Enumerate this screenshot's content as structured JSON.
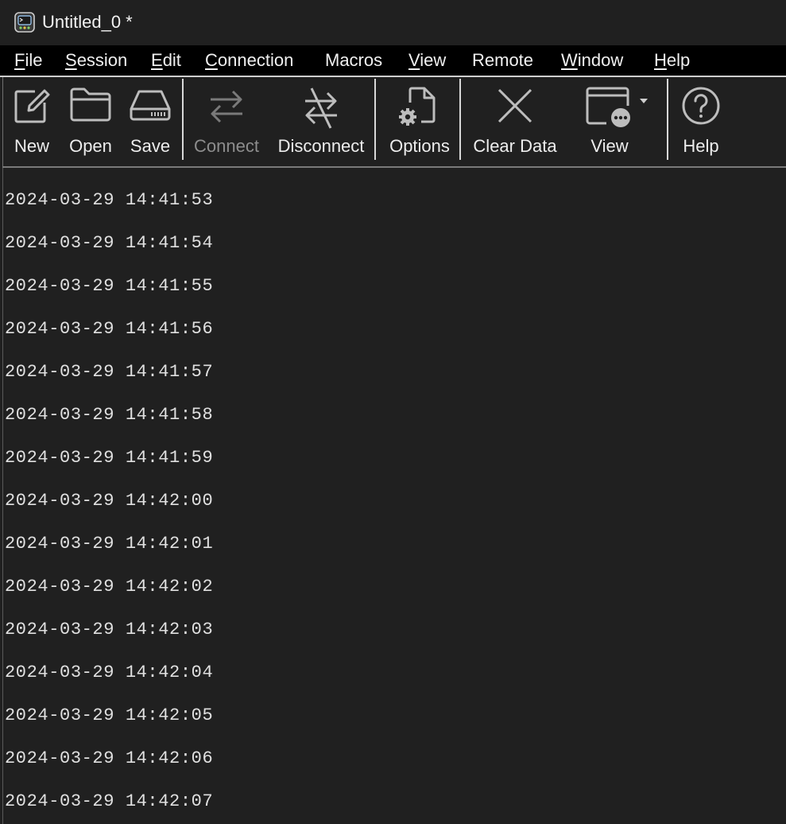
{
  "window": {
    "title": "Untitled_0 *",
    "app_icon": "serial-terminal-icon"
  },
  "menu": {
    "items": [
      {
        "underline": "F",
        "rest": "ile"
      },
      {
        "underline": "S",
        "rest": "ession"
      },
      {
        "underline": "E",
        "rest": "dit"
      },
      {
        "underline": "C",
        "rest": "onnection"
      },
      {
        "underline": "",
        "rest": "Macros"
      },
      {
        "underline": "V",
        "rest": "iew"
      },
      {
        "underline": "",
        "rest": "Remote"
      },
      {
        "underline": "W",
        "rest": "indow"
      },
      {
        "underline": "H",
        "rest": "elp"
      }
    ]
  },
  "toolbar": {
    "new": {
      "label": "New",
      "icon": "new-document-icon"
    },
    "open": {
      "label": "Open",
      "icon": "folder-icon"
    },
    "save": {
      "label": "Save",
      "icon": "drive-save-icon"
    },
    "connect": {
      "label": "Connect",
      "icon": "connect-arrows-icon",
      "enabled": false
    },
    "disconnect": {
      "label": "Disconnect",
      "icon": "disconnect-arrows-icon"
    },
    "options": {
      "label": "Options",
      "icon": "document-gear-icon"
    },
    "clear": {
      "label": "Clear Data",
      "icon": "close-x-icon"
    },
    "view": {
      "label": "View",
      "icon": "window-more-icon"
    },
    "help": {
      "label": "Help",
      "icon": "help-circle-icon"
    }
  },
  "terminal": {
    "lines": [
      "2024-03-29 14:41:53",
      "2024-03-29 14:41:54",
      "2024-03-29 14:41:55",
      "2024-03-29 14:41:56",
      "2024-03-29 14:41:57",
      "2024-03-29 14:41:58",
      "2024-03-29 14:41:59",
      "2024-03-29 14:42:00",
      "2024-03-29 14:42:01",
      "2024-03-29 14:42:02",
      "2024-03-29 14:42:03",
      "2024-03-29 14:42:04",
      "2024-03-29 14:42:05",
      "2024-03-29 14:42:06",
      "2024-03-29 14:42:07"
    ]
  },
  "colors": {
    "background": "#202020",
    "menubar": "#000000",
    "text": "#e6e6e6",
    "disabled": "#8d8d8d"
  }
}
